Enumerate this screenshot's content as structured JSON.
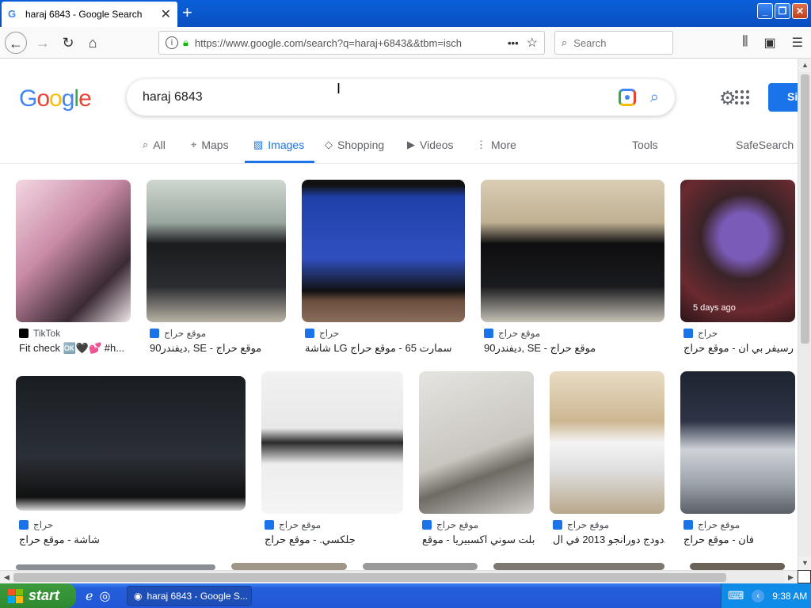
{
  "browser": {
    "tab_title": "haraj 6843 - Google Search",
    "new_tab": "+",
    "url": "https://www.google.com/search?q=haraj+6843&&tbm=isch",
    "search_placeholder": "Search",
    "page_actions": "•••"
  },
  "google": {
    "query": "haraj 6843",
    "signin_label": "Si",
    "tabs": [
      {
        "label": "All",
        "icon": "search-icon"
      },
      {
        "label": "Maps",
        "icon": "map-pin-icon"
      },
      {
        "label": "Images",
        "icon": "image-icon"
      },
      {
        "label": "Shopping",
        "icon": "tag-icon"
      },
      {
        "label": "Videos",
        "icon": "play-icon"
      },
      {
        "label": "More",
        "icon": "more-vert-icon"
      }
    ],
    "tools_label": "Tools",
    "safesearch_label": "SafeSearch"
  },
  "results": [
    {
      "source": "TikTok",
      "caption": "Fit check 🆗🖤💕 #h...",
      "age": ""
    },
    {
      "source": "موقع حراج",
      "caption": "ديفندر90, SE - موقع حراج",
      "age": ""
    },
    {
      "source": "حراج",
      "caption": "شاشة LG سمارت 65 - موقع حراج",
      "age": ""
    },
    {
      "source": "موقع حراج",
      "caption": "ديفندر90, SE - موقع حراج",
      "age": ""
    },
    {
      "source": "حراج",
      "caption": "رسيفر بي ان - موقع حراج",
      "age": "5 days ago"
    },
    {
      "source": "حراج",
      "caption": "شاشة - موقع حراج",
      "age": ""
    },
    {
      "source": "موقع حراج",
      "caption": "جلكسي. - موقع حراج",
      "age": ""
    },
    {
      "source": "موقع حراج",
      "caption": "تابلت سوني اكسبيريا - موقع ...",
      "age": ""
    },
    {
      "source": "موقع حراج",
      "caption": "دودج دورانجو 2013 في ال...",
      "age": ""
    },
    {
      "source": "موقع حراج",
      "caption": "فان - موقع حراج",
      "age": ""
    }
  ],
  "taskbar": {
    "start_label": "start",
    "task_label": "haraj 6843 - Google S...",
    "clock": "9:38 AM"
  }
}
